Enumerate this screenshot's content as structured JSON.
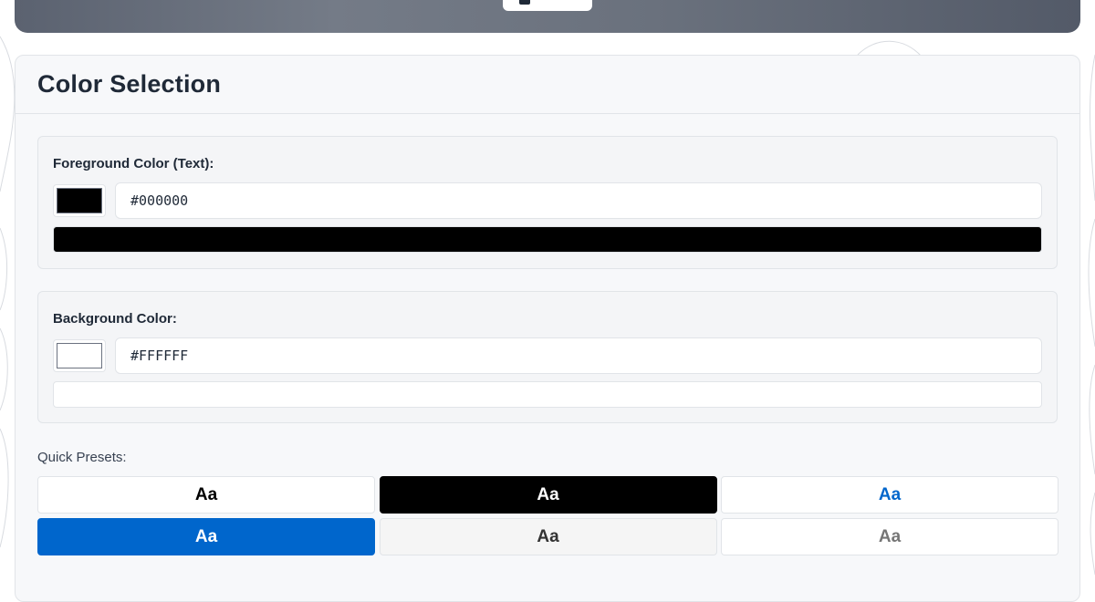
{
  "card": {
    "title": "Color Selection"
  },
  "foreground": {
    "label": "Foreground Color (Text):",
    "value": "#000000",
    "color": "#000000"
  },
  "background": {
    "label": "Background Color:",
    "value": "#FFFFFF",
    "color": "#FFFFFF"
  },
  "presets": {
    "label": "Quick Presets:",
    "items": [
      {
        "text": "Aa",
        "fg": "#000000",
        "bg": "#FFFFFF"
      },
      {
        "text": "Aa",
        "fg": "#FFFFFF",
        "bg": "#000000"
      },
      {
        "text": "Aa",
        "fg": "#0066CC",
        "bg": "#FFFFFF"
      },
      {
        "text": "Aa",
        "fg": "#FFFFFF",
        "bg": "#0066CC"
      },
      {
        "text": "Aa",
        "fg": "#333333",
        "bg": "#F5F5F5"
      },
      {
        "text": "Aa",
        "fg": "#767676",
        "bg": "#FFFFFF"
      }
    ]
  }
}
